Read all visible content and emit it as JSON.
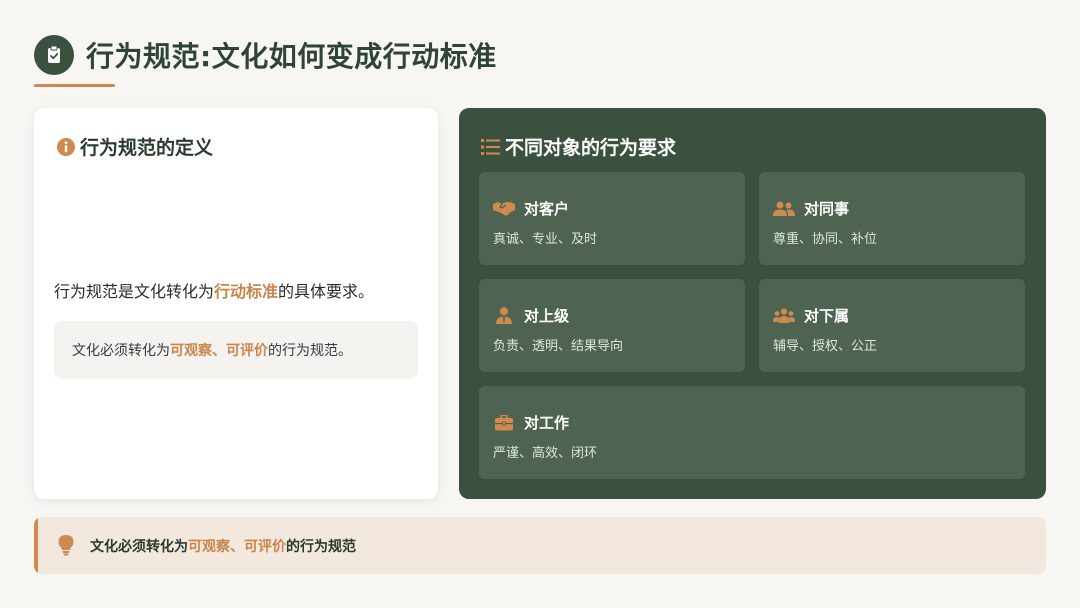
{
  "header": {
    "title": "行为规范:文化如何变成行动标准",
    "icon": "clipboard-check-icon"
  },
  "left_card": {
    "heading": "行为规范的定义",
    "heading_icon": "info-circle-icon",
    "definition_prefix": "行为规范是文化转化为",
    "definition_highlight": "行动标准",
    "definition_suffix": "的具体要求。",
    "box_prefix": "文化必须转化为",
    "box_highlight": "可观察、可评价",
    "box_suffix": "的行为规范。"
  },
  "right_card": {
    "heading": "不同对象的行为要求",
    "heading_icon": "list-icon",
    "items": [
      {
        "title": "对客户",
        "desc": "真诚、专业、及时",
        "icon": "handshake-icon"
      },
      {
        "title": "对同事",
        "desc": "尊重、协同、补位",
        "icon": "users-icon"
      },
      {
        "title": "对上级",
        "desc": "负责、透明、结果导向",
        "icon": "user-tie-icon"
      },
      {
        "title": "对下属",
        "desc": "辅导、授权、公正",
        "icon": "people-group-icon"
      },
      {
        "title": "对工作",
        "desc": "严谨、高效、闭环",
        "icon": "briefcase-icon"
      }
    ]
  },
  "bottom": {
    "icon": "lightbulb-icon",
    "prefix": "文化必须转化为",
    "highlight": "可观察、可评价",
    "suffix": "的行为规范"
  },
  "colors": {
    "primary_green": "#3b5140",
    "tile_green": "#4e6352",
    "accent_orange": "#cf8a4f",
    "background": "#f8f6f3"
  }
}
